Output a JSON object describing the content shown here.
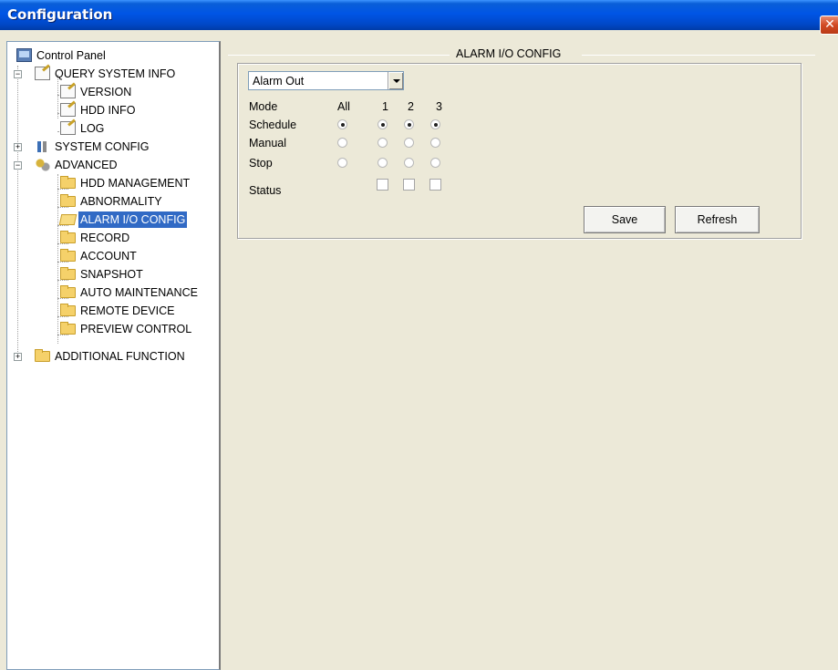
{
  "window": {
    "title": "Configuration",
    "close_glyph": "✕"
  },
  "tree": {
    "items": [
      {
        "label": "Control Panel",
        "icon": "monitor-icon"
      },
      {
        "label": "QUERY SYSTEM INFO",
        "icon": "note-icon",
        "expander": "−"
      },
      {
        "label": "VERSION",
        "icon": "note-icon"
      },
      {
        "label": "HDD INFO",
        "icon": "note-icon"
      },
      {
        "label": "LOG",
        "icon": "note-icon"
      },
      {
        "label": "SYSTEM CONFIG",
        "icon": "tools-icon",
        "expander": "+"
      },
      {
        "label": "ADVANCED",
        "icon": "gears-icon",
        "expander": "−"
      },
      {
        "label": "HDD MANAGEMENT",
        "icon": "folder-icon"
      },
      {
        "label": "ABNORMALITY",
        "icon": "folder-icon"
      },
      {
        "label": "ALARM I/O CONFIG",
        "icon": "folder-open-icon",
        "selected": true
      },
      {
        "label": "RECORD",
        "icon": "folder-icon"
      },
      {
        "label": "ACCOUNT",
        "icon": "folder-icon"
      },
      {
        "label": "SNAPSHOT",
        "icon": "folder-icon"
      },
      {
        "label": "AUTO MAINTENANCE",
        "icon": "folder-icon"
      },
      {
        "label": "REMOTE DEVICE",
        "icon": "folder-icon"
      },
      {
        "label": "PREVIEW CONTROL",
        "icon": "folder-icon"
      },
      {
        "label": "ADDITIONAL FUNCTION",
        "icon": "folder-icon",
        "expander": "+"
      }
    ]
  },
  "alarm_io": {
    "group_title": "ALARM I/O CONFIG",
    "type_select": {
      "value": "Alarm Out"
    },
    "columns": {
      "mode": "Mode",
      "all": "All",
      "c1": "1",
      "c2": "2",
      "c3": "3"
    },
    "rows": [
      {
        "label": "Schedule",
        "all": true,
        "c1": true,
        "c2": true,
        "c3": true
      },
      {
        "label": "Manual",
        "all": false,
        "c1": false,
        "c2": false,
        "c3": false
      },
      {
        "label": "Stop",
        "all": false,
        "c1": false,
        "c2": false,
        "c3": false
      }
    ],
    "status": {
      "label": "Status",
      "c1": false,
      "c2": false,
      "c3": false
    },
    "buttons": {
      "save": "Save",
      "refresh": "Refresh"
    }
  },
  "colors": {
    "title_bar": "#0055e5",
    "selection": "#316ac5",
    "face": "#ece9d8"
  }
}
